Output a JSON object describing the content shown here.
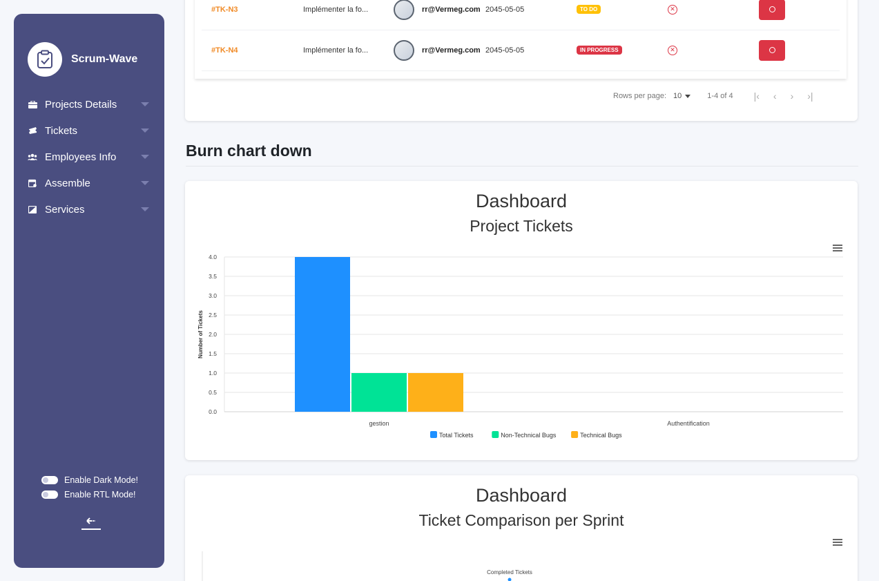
{
  "sidebar": {
    "brand": "Scrum-Wave",
    "items": [
      {
        "label": "Projects Details",
        "icon": "briefcase-icon"
      },
      {
        "label": "Tickets",
        "icon": "ticket-icon"
      },
      {
        "label": "Employees Info",
        "icon": "users-icon"
      },
      {
        "label": "Assemble",
        "icon": "calendar-icon"
      },
      {
        "label": "Services",
        "icon": "window-icon"
      }
    ],
    "dark_mode_label": "Enable Dark Mode!",
    "rtl_mode_label": "Enable RTL Mode!"
  },
  "tickets_table": {
    "rows": [
      {
        "id": "#TK-N3",
        "description": "Implémenter la fo...",
        "email": "rr@Vermeg.com",
        "date": "2045-05-05",
        "status": "TO DO"
      },
      {
        "id": "#TK-N4",
        "description": "Implémenter la fo...",
        "email": "rr@Vermeg.com",
        "date": "2045-05-05",
        "status": "IN PROGRESS"
      }
    ],
    "pagination": {
      "rows_per_page_label": "Rows per page:",
      "rows_per_page": "10",
      "range": "1-4 of 4"
    }
  },
  "section_title": "Burn chart down",
  "charts": {
    "project": {
      "title": "Dashboard",
      "subtitle": "Project Tickets"
    },
    "sprint": {
      "title": "Dashboard",
      "subtitle": "Ticket Comparison per Sprint"
    }
  },
  "chart_data": [
    {
      "type": "bar",
      "title": "Dashboard",
      "subtitle": "Project Tickets",
      "xlabel": "",
      "ylabel": "Number of Tickets",
      "ylim": [
        0,
        4
      ],
      "yticks": [
        0.0,
        0.5,
        1.0,
        1.5,
        2.0,
        2.5,
        3.0,
        3.5,
        4.0
      ],
      "categories": [
        "gestion",
        "Authentification"
      ],
      "series": [
        {
          "name": "Total Tickets",
          "color": "#1e90ff",
          "values": [
            4,
            0
          ]
        },
        {
          "name": "Non-Technical Bugs",
          "color": "#00e396",
          "values": [
            1,
            0
          ]
        },
        {
          "name": "Technical Bugs",
          "color": "#feb019",
          "values": [
            1,
            0
          ]
        }
      ],
      "legend": "bottom",
      "grid": true
    },
    {
      "type": "line",
      "title": "Dashboard",
      "subtitle": "Ticket Comparison per Sprint",
      "series": [
        {
          "name": "Completed Tickets",
          "color": "#1e90ff"
        }
      ],
      "annotations": [
        "Completed Tickets"
      ]
    }
  ]
}
